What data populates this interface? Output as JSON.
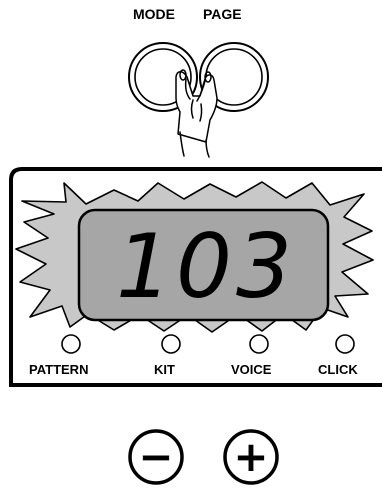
{
  "buttons": {
    "mode_label": "MODE",
    "page_label": "PAGE",
    "minus_symbol": "−",
    "plus_symbol": "+"
  },
  "display": {
    "value": "103",
    "lcd_color": "#a6a6a6",
    "burst_color": "#c8c8c8"
  },
  "indicators": [
    {
      "label": "PATTERN"
    },
    {
      "label": "KIT"
    },
    {
      "label": "VOICE"
    },
    {
      "label": "CLICK"
    }
  ],
  "icons": {
    "hand": "hand-pressing-icon"
  }
}
